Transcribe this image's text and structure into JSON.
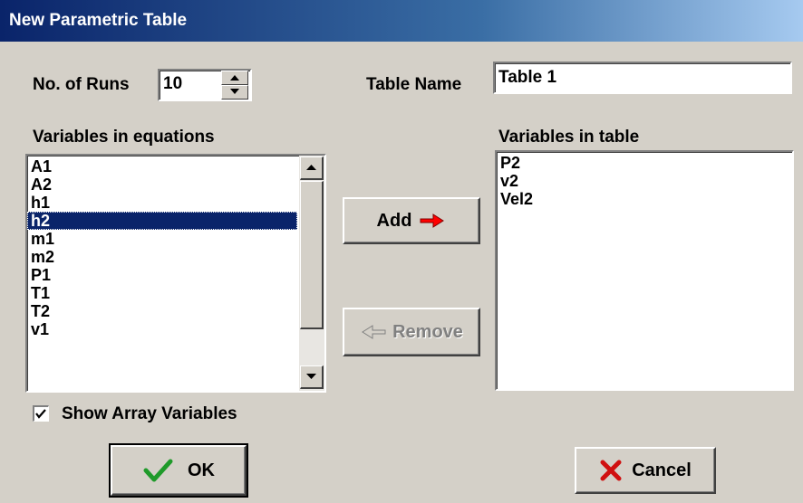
{
  "window": {
    "title": "New Parametric Table"
  },
  "runs": {
    "label": "No. of Runs",
    "value": "10"
  },
  "table_name": {
    "label": "Table Name",
    "value": "Table 1"
  },
  "equations_list": {
    "label": "Variables in equations",
    "items": [
      "A1",
      "A2",
      "h1",
      "h2",
      "m1",
      "m2",
      "P1",
      "T1",
      "T2",
      "v1"
    ],
    "selected": "h2"
  },
  "table_list": {
    "label": "Variables in table",
    "items": [
      "P2",
      "v2",
      "Vel2"
    ]
  },
  "buttons": {
    "add": "Add",
    "remove": "Remove",
    "ok": "OK",
    "cancel": "Cancel"
  },
  "show_array": {
    "label": "Show Array Variables",
    "checked": true
  },
  "colors": {
    "title_start": "#0a246a",
    "title_end": "#a6caf0",
    "selection": "#0a246a",
    "dialog_bg": "#d4d0c8"
  },
  "icons": {
    "add": "red-arrow-right-icon",
    "remove": "arrow-left-icon",
    "ok": "green-check-icon",
    "cancel": "red-x-icon"
  }
}
